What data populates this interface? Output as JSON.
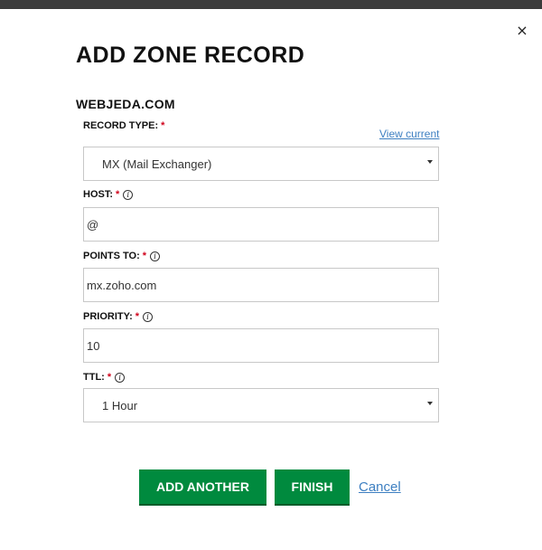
{
  "dialog": {
    "title": "ADD ZONE RECORD",
    "domain": "WEBJEDA.COM",
    "close_label": "×"
  },
  "form": {
    "record_type": {
      "label": "RECORD TYPE:",
      "required_mark": "*",
      "link": "View current",
      "value": "MX (Mail Exchanger)"
    },
    "host": {
      "label": "HOST:",
      "required_mark": "*",
      "info_glyph": "i",
      "value": "@"
    },
    "points_to": {
      "label": "POINTS TO:",
      "required_mark": "*",
      "info_glyph": "i",
      "value": "mx.zoho.com"
    },
    "priority": {
      "label": "PRIORITY:",
      "required_mark": "*",
      "info_glyph": "i",
      "value": "10"
    },
    "ttl": {
      "label": "TTL:",
      "required_mark": "*",
      "info_glyph": "i",
      "value": "1 Hour"
    }
  },
  "actions": {
    "add_another": "ADD ANOTHER",
    "finish": "FINISH",
    "cancel": "Cancel"
  },
  "colors": {
    "primary_button": "#008a3e",
    "link": "#3d7fc1",
    "required": "#d0021b"
  }
}
